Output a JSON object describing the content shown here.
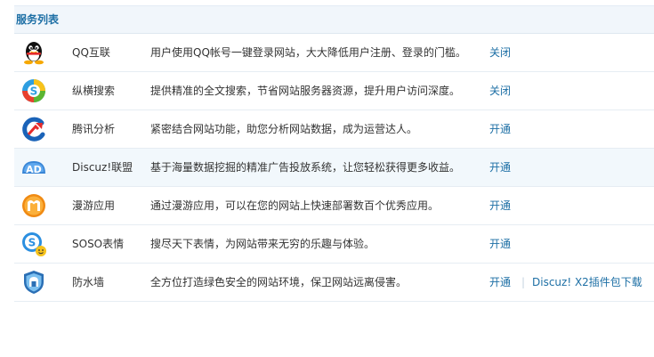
{
  "panel": {
    "title": "服务列表"
  },
  "services": [
    {
      "icon": "qq-penguin-icon",
      "name": "QQ互联",
      "desc": "用户使用QQ帐号一键登录网站，大大降低用户注册、登录的门槛。",
      "action": "关闭"
    },
    {
      "icon": "search-swirl-icon",
      "name": "纵横搜索",
      "desc": "提供精准的全文搜索，节省网站服务器资源，提升用户访问深度。",
      "action": "关闭"
    },
    {
      "icon": "analytics-icon",
      "name": "腾讯分析",
      "desc": "紧密结合网站功能，助您分析网站数据，成为运营达人。",
      "action": "开通"
    },
    {
      "icon": "ad-icon",
      "name": "Discuz!联盟",
      "desc": "基于海量数据挖掘的精准广告投放系统，让您轻松获得更多收益。",
      "action": "开通"
    },
    {
      "icon": "manyou-icon",
      "name": "漫游应用",
      "desc": "通过漫游应用，可以在您的网站上快速部署数百个优秀应用。",
      "action": "开通"
    },
    {
      "icon": "soso-emoticon-icon",
      "name": "SOSO表情",
      "desc": "搜尽天下表情，为网站带来无穷的乐趣与体验。",
      "action": "开通"
    },
    {
      "icon": "firewall-shield-icon",
      "name": "防水墙",
      "desc": "全方位打造绿色安全的网站环境，保卫网站远离侵害。",
      "action": "开通",
      "separator": "|",
      "extra": "Discuz! X2插件包下载"
    }
  ],
  "colors": {
    "link": "#1d6fa5",
    "header_bg": "#f1f6fb",
    "row_highlight": "#f2f8fc"
  }
}
